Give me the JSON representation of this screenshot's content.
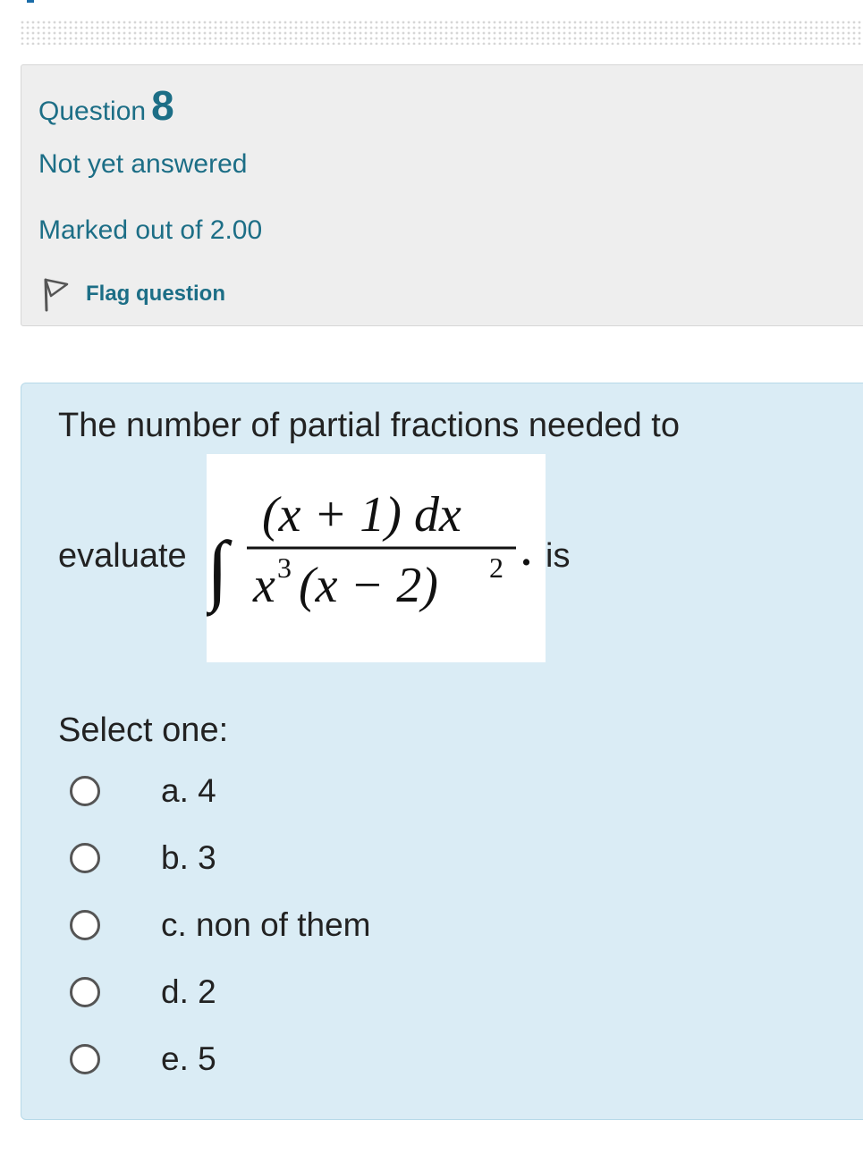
{
  "info": {
    "question_label": "Question",
    "question_number": "8",
    "state": "Not yet answered",
    "grade": "Marked out of 2.00",
    "flag_label": "Flag question",
    "flag_icon": "flag-icon"
  },
  "question": {
    "text_line1": "The number of partial fractions needed to",
    "text_before_formula": "evaluate",
    "text_after_formula": "is",
    "formula": {
      "integral_sign": "∫",
      "numerator": "(x + 1) dx",
      "denominator_x": "x",
      "denominator_x_power": "3",
      "denominator_rest": "(x − 2)",
      "denominator_rest_power": "2",
      "trailing_dot": "."
    },
    "prompt": "Select one:",
    "options": [
      {
        "label": "a. 4",
        "selected": false
      },
      {
        "label": "b. 3",
        "selected": false
      },
      {
        "label": "c. non of them",
        "selected": false
      },
      {
        "label": "d. 2",
        "selected": false
      },
      {
        "label": "e. 5",
        "selected": false
      }
    ]
  },
  "colors": {
    "info_text": "#1c6e86",
    "info_background": "#eeeeee",
    "content_background": "#daecf5",
    "radio_border": "#555555"
  }
}
